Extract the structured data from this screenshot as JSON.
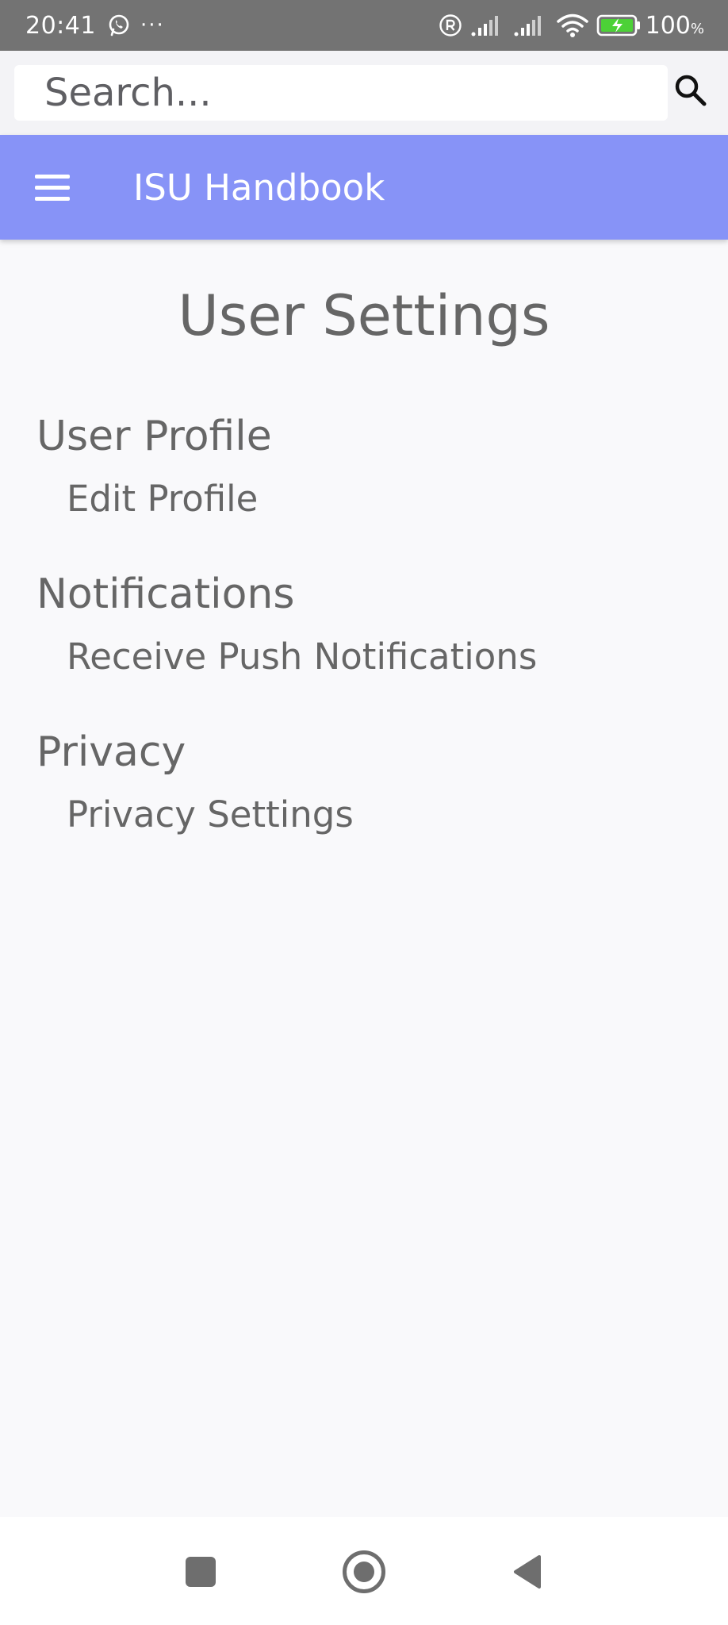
{
  "status_bar": {
    "time": "20:41",
    "dots": "···",
    "battery_percent": "100",
    "percent_sign": "%",
    "icons": [
      "whatsapp-icon",
      "registered-icon",
      "signal-icon",
      "signal-icon",
      "wifi-icon",
      "battery-charging-icon"
    ]
  },
  "search": {
    "placeholder": "Search...",
    "icon": "search-icon"
  },
  "app_bar": {
    "title": "ISU Handbook",
    "menu_icon": "menu-icon"
  },
  "page": {
    "title": "User Settings",
    "sections": [
      {
        "heading": "User Profile",
        "item": "Edit Profile"
      },
      {
        "heading": "Notifications",
        "item": "Receive Push Notifications"
      },
      {
        "heading": "Privacy",
        "item": "Privacy Settings"
      }
    ]
  },
  "nav_bar": {
    "icons": [
      "recent-apps-icon",
      "home-icon",
      "back-icon"
    ]
  },
  "colors": {
    "status_bar": "#737373",
    "app_bar": "#8793f7",
    "background": "#f9f9fb",
    "text": "#666666",
    "battery_green": "#4cd137"
  }
}
